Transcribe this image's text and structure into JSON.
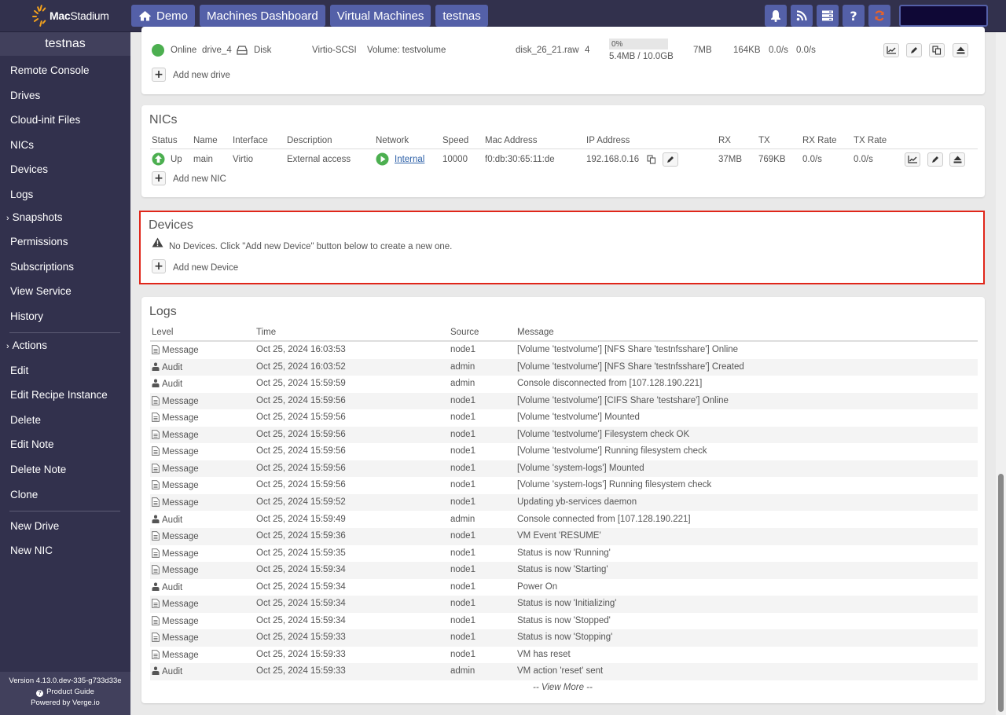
{
  "topbar": {
    "logo": {
      "bold": "Mac",
      "light": "Stadium"
    },
    "breadcrumbs": [
      {
        "label": "Demo",
        "icon": "home-icon"
      },
      {
        "label": "Machines Dashboard"
      },
      {
        "label": "Virtual Machines"
      },
      {
        "label": "testnas"
      }
    ],
    "icons": [
      "bell-icon",
      "rss-icon",
      "server-list-icon",
      "help-icon",
      "refresh-icon"
    ],
    "search": {
      "value": "",
      "placeholder": ""
    }
  },
  "sidebar": {
    "title": "testnas",
    "items": [
      {
        "label": "Remote Console"
      },
      {
        "label": "Drives"
      },
      {
        "label": "Cloud-init Files"
      },
      {
        "label": "NICs"
      },
      {
        "label": "Devices"
      },
      {
        "label": "Logs"
      },
      {
        "label": "Snapshots",
        "expandable": true
      },
      {
        "label": "Permissions"
      },
      {
        "label": "Subscriptions"
      },
      {
        "label": "View Service"
      },
      {
        "label": "History"
      }
    ],
    "actions_header": "Actions",
    "actions": [
      {
        "label": "Edit"
      },
      {
        "label": "Edit Recipe Instance"
      },
      {
        "label": "Delete"
      },
      {
        "label": "Edit Note"
      },
      {
        "label": "Delete Note"
      },
      {
        "label": "Clone"
      }
    ],
    "new_items": [
      {
        "label": "New Drive"
      },
      {
        "label": "New NIC"
      }
    ],
    "footer": {
      "version": "Version 4.13.0.dev-335-g733d33e",
      "product_guide": "Product Guide",
      "powered_by": "Powered by Verge.io"
    }
  },
  "drives": {
    "row": {
      "status": "Online",
      "name": "drive_4",
      "media": "Disk",
      "interface": "Virtio-SCSI",
      "preferred_tier": "Volume: testvolume",
      "filename": "disk_26_21.raw",
      "tier": "4",
      "usage_percent": 0,
      "usage_label": "0%",
      "usage_detail": "5.4MB / 10.0GB",
      "read": "7MB",
      "write": "164KB",
      "read_rate": "0.0/s",
      "write_rate": "0.0/s"
    },
    "add_label": "Add new drive"
  },
  "nics": {
    "title": "NICs",
    "columns": [
      "Status",
      "Name",
      "Interface",
      "Description",
      "Network",
      "Speed",
      "Mac Address",
      "IP Address",
      "RX",
      "TX",
      "RX Rate",
      "TX Rate"
    ],
    "row": {
      "status": "Up",
      "name": "main",
      "interface": "Virtio",
      "description": "External access",
      "network": "Internal",
      "speed": "10000",
      "mac": "f0:db:30:65:11:de",
      "ip": "192.168.0.16",
      "rx": "37MB",
      "tx": "769KB",
      "rx_rate": "0.0/s",
      "tx_rate": "0.0/s"
    },
    "add_label": "Add new NIC"
  },
  "devices": {
    "title": "Devices",
    "empty_message": "No Devices. Click \"Add new Device\" button below to create a new one.",
    "add_label": "Add new Device"
  },
  "logs": {
    "title": "Logs",
    "columns": [
      "Level",
      "Time",
      "Source",
      "Message"
    ],
    "rows": [
      {
        "level": "Message",
        "time": "Oct 25, 2024 16:03:53",
        "source": "node1",
        "message": "[Volume 'testvolume'] [NFS Share 'testnfsshare'] Online"
      },
      {
        "level": "Audit",
        "time": "Oct 25, 2024 16:03:52",
        "source": "admin",
        "message": "[Volume 'testvolume'] [NFS Share 'testnfsshare'] Created"
      },
      {
        "level": "Audit",
        "time": "Oct 25, 2024 15:59:59",
        "source": "admin",
        "message": "Console disconnected from [107.128.190.221]"
      },
      {
        "level": "Message",
        "time": "Oct 25, 2024 15:59:56",
        "source": "node1",
        "message": "[Volume 'testvolume'] [CIFS Share 'testshare'] Online"
      },
      {
        "level": "Message",
        "time": "Oct 25, 2024 15:59:56",
        "source": "node1",
        "message": "[Volume 'testvolume'] Mounted"
      },
      {
        "level": "Message",
        "time": "Oct 25, 2024 15:59:56",
        "source": "node1",
        "message": "[Volume 'testvolume'] Filesystem check OK"
      },
      {
        "level": "Message",
        "time": "Oct 25, 2024 15:59:56",
        "source": "node1",
        "message": "[Volume 'testvolume'] Running filesystem check"
      },
      {
        "level": "Message",
        "time": "Oct 25, 2024 15:59:56",
        "source": "node1",
        "message": "[Volume 'system-logs'] Mounted"
      },
      {
        "level": "Message",
        "time": "Oct 25, 2024 15:59:56",
        "source": "node1",
        "message": "[Volume 'system-logs'] Running filesystem check"
      },
      {
        "level": "Message",
        "time": "Oct 25, 2024 15:59:52",
        "source": "node1",
        "message": "Updating yb-services daemon"
      },
      {
        "level": "Audit",
        "time": "Oct 25, 2024 15:59:49",
        "source": "admin",
        "message": "Console connected from [107.128.190.221]"
      },
      {
        "level": "Message",
        "time": "Oct 25, 2024 15:59:36",
        "source": "node1",
        "message": "VM Event 'RESUME'"
      },
      {
        "level": "Message",
        "time": "Oct 25, 2024 15:59:35",
        "source": "node1",
        "message": "Status is now 'Running'"
      },
      {
        "level": "Message",
        "time": "Oct 25, 2024 15:59:34",
        "source": "node1",
        "message": "Status is now 'Starting'"
      },
      {
        "level": "Audit",
        "time": "Oct 25, 2024 15:59:34",
        "source": "node1",
        "message": "Power On"
      },
      {
        "level": "Message",
        "time": "Oct 25, 2024 15:59:34",
        "source": "node1",
        "message": "Status is now 'Initializing'"
      },
      {
        "level": "Message",
        "time": "Oct 25, 2024 15:59:34",
        "source": "node1",
        "message": "Status is now 'Stopped'"
      },
      {
        "level": "Message",
        "time": "Oct 25, 2024 15:59:33",
        "source": "node1",
        "message": "Status is now 'Stopping'"
      },
      {
        "level": "Message",
        "time": "Oct 25, 2024 15:59:33",
        "source": "node1",
        "message": "VM has reset"
      },
      {
        "level": "Audit",
        "time": "Oct 25, 2024 15:59:33",
        "source": "admin",
        "message": "VM action 'reset' sent"
      }
    ],
    "view_more": "-- View More --"
  },
  "colors": {
    "nav_bg": "#32314d",
    "accent": "#5460a8",
    "online_green": "#4caf50",
    "highlight_red": "#e0261a",
    "refresh_orange": "#e8622a",
    "logo_orange": "#f4a21d"
  }
}
